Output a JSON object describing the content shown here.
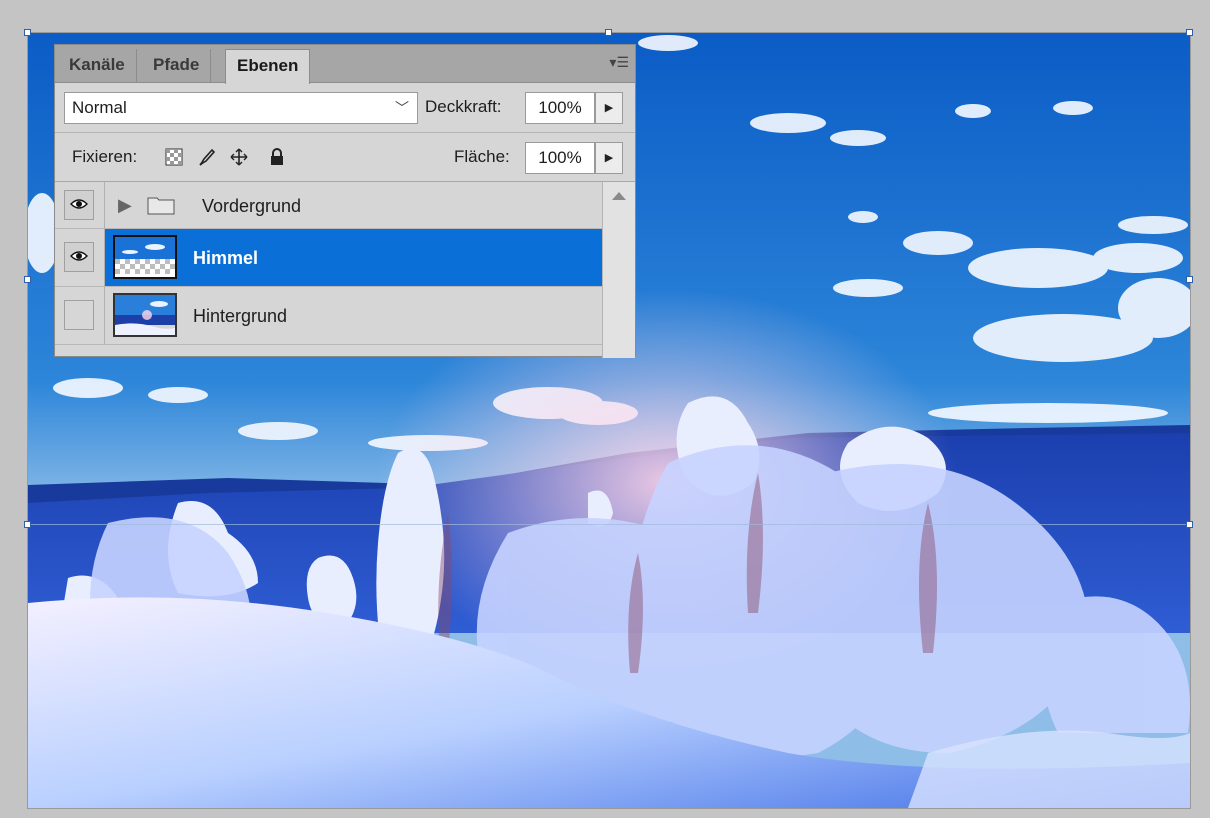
{
  "panel": {
    "tabs": [
      {
        "label": "Kanäle",
        "active": false
      },
      {
        "label": "Pfade",
        "active": false
      },
      {
        "label": "Ebenen",
        "active": true
      }
    ],
    "menu_icon": "panel-menu-icon",
    "blend_mode": "Normal",
    "opacity_label": "Deckkraft:",
    "opacity_value": "100%",
    "lock_label": "Fixieren:",
    "lock_icons": [
      "lock-transparent-pixels-icon",
      "lock-image-pixels-icon",
      "lock-position-icon",
      "lock-all-icon"
    ],
    "fill_label": "Fläche:",
    "fill_value": "100%",
    "layers": [
      {
        "name": "Vordergrund",
        "type": "group",
        "visible": true,
        "selected": false
      },
      {
        "name": "Himmel",
        "type": "layer",
        "visible": true,
        "selected": true
      },
      {
        "name": "Hintergrund",
        "type": "layer",
        "visible": false,
        "selected": false
      }
    ]
  },
  "colors": {
    "selection": "#0a6fd6",
    "panel_bg": "#d6d6d6",
    "sky_top": "#0f63c9",
    "sky_bottom": "#7fb3e4"
  }
}
